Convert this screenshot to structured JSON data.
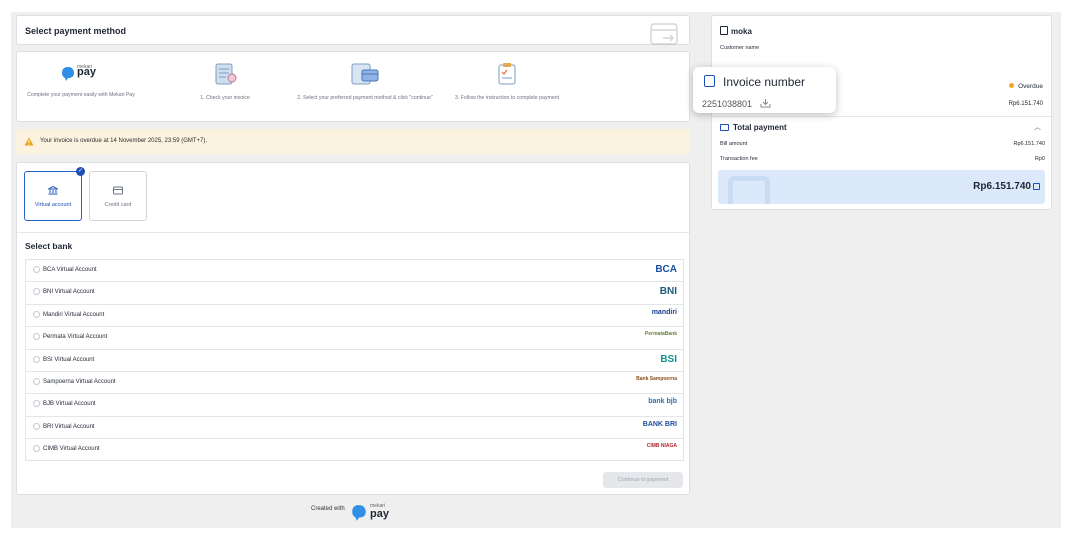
{
  "header": {
    "title": "Select payment method"
  },
  "steps": [
    {
      "label": "Complete your payment easily with Mekari Pay"
    },
    {
      "label": "1. Check your invoice"
    },
    {
      "label": "2. Select your preferred payment method & click \"continue\""
    },
    {
      "label": "3. Follow the instruction to complete payment"
    }
  ],
  "brand": {
    "small": "mekari",
    "big": "pay"
  },
  "banner": {
    "text": "Your invoice is overdue at 14 November 2025, 23:59 (GMT+7)."
  },
  "methods": [
    {
      "label": "Virtual account",
      "selected": true
    },
    {
      "label": "Credit card",
      "selected": false
    }
  ],
  "select_bank_label": "Select bank",
  "banks": [
    {
      "name": "BCA Virtual Account",
      "logo": "BCA",
      "logo_color": "#1a4fa0"
    },
    {
      "name": "BNI Virtual Account",
      "logo": "BNI",
      "logo_color": "#1b5c7a"
    },
    {
      "name": "Mandiri Virtual Account",
      "logo": "mandiri",
      "logo_color": "#1b3f8f"
    },
    {
      "name": "Permata Virtual Account",
      "logo": "PermataBank",
      "logo_color": "#6a7f3a"
    },
    {
      "name": "BSI Virtual Account",
      "logo": "BSI",
      "logo_color": "#10928f"
    },
    {
      "name": "Sampoerna Virtual Account",
      "logo": "Bank Sampoerna",
      "logo_color": "#8a4b17"
    },
    {
      "name": "BJB Virtual Account",
      "logo": "bank bjb",
      "logo_color": "#2a6fb3"
    },
    {
      "name": "BRI Virtual Account",
      "logo": "BANK BRI",
      "logo_color": "#1b4e9a"
    },
    {
      "name": "CIMB Virtual Account",
      "logo": "CIMB NIAGA",
      "logo_color": "#b3262b"
    }
  ],
  "continue_label": "Continue to payment",
  "footer": {
    "created_with": "Created with"
  },
  "summary": {
    "merchant": "moka",
    "customer_label": "Customer name",
    "status": "Overdue",
    "amount": "Rp6.151.740",
    "total_payment_label": "Total payment",
    "bill_amount_label": "Bill amount",
    "bill_amount": "Rp6.151.740",
    "transaction_fee_label": "Transaction fee",
    "transaction_fee": "Rp0",
    "total": "Rp6.151.740"
  },
  "tooltip": {
    "title": "Invoice number",
    "number": "2251038801"
  },
  "colors": {
    "accent": "#1d4fb8",
    "overdue": "#f5a524",
    "banner_bg": "#fbf3df",
    "total_bg": "#dbe9fb"
  }
}
